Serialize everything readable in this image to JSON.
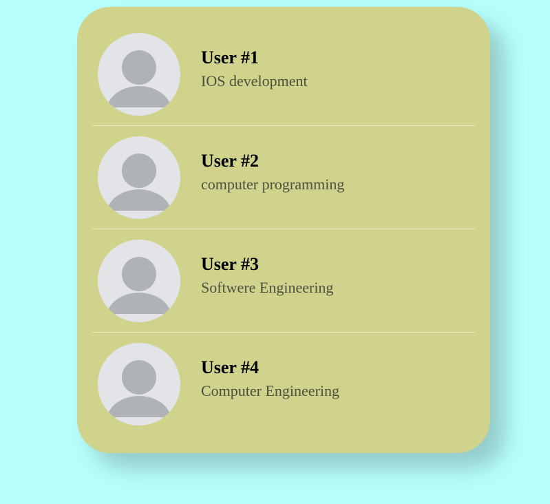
{
  "colors": {
    "page_background": "#b6fffd",
    "card_background": "#cfd38c",
    "divider": "#e8ebc4",
    "avatar_background": "#e2e4e8",
    "avatar_silhouette": "#afb3b7",
    "name_text": "#000000",
    "role_text": "#4d4f3f"
  },
  "users": [
    {
      "name": "User #1",
      "role": "IOS development",
      "avatar_icon": "user-silhouette-icon"
    },
    {
      "name": "User #2",
      "role": "computer programming",
      "avatar_icon": "user-silhouette-icon"
    },
    {
      "name": "User #3",
      "role": "Softwere Engineering",
      "avatar_icon": "user-silhouette-icon"
    },
    {
      "name": "User #4",
      "role": "Computer Engineering",
      "avatar_icon": "user-silhouette-icon"
    }
  ]
}
